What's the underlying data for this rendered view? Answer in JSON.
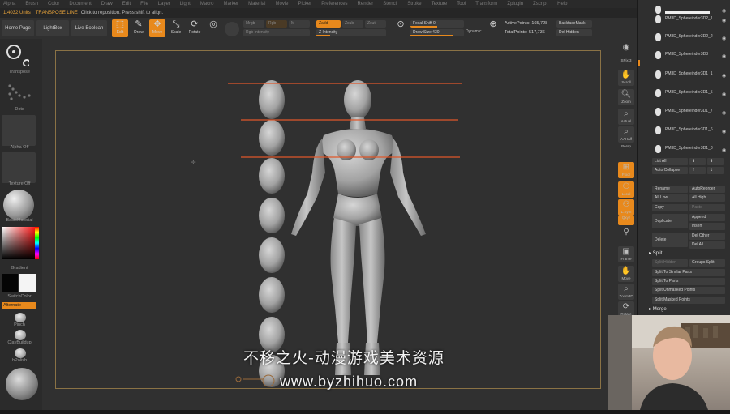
{
  "menubar": {
    "items": [
      "Alpha",
      "Brush",
      "Color",
      "Document",
      "Draw",
      "Edit",
      "File",
      "Layer",
      "Light",
      "Macro",
      "Marker",
      "Material",
      "Movie",
      "Picker",
      "Preferences",
      "Render",
      "Stencil",
      "Stroke",
      "Texture",
      "Tool",
      "Transform",
      "Zplugin",
      "Zscript",
      "Help"
    ]
  },
  "info": {
    "units": "1.4032 Units",
    "mode": "TRANSPOSE LINE",
    "hint": "Click to reposition. Press shift to align."
  },
  "top": {
    "home": "Home Page",
    "lightbox": "LightBox",
    "liveboolean": "Live Boolean",
    "edit": "Edit",
    "draw": "Draw",
    "move": "Move",
    "scale": "Scale",
    "rotate": "Rotate",
    "mrgb": "Mrgb",
    "rgb": "Rgb",
    "m": "M",
    "zadd": "Zadd",
    "zsub": "Zsub",
    "zcut": "Zcut",
    "rgb_intensity": "Rgb Intensity",
    "z_intensity": "Z Intensity",
    "focal_shift": "Focal Shift 0",
    "draw_size": "Draw Size 430",
    "dynamic": "Dynamic",
    "active_points": "ActivePoints: 165,728",
    "total_points": "TotalPoints: 517,736",
    "backface": "BackfaceMask",
    "del_hidden": "Del Hidden"
  },
  "left": {
    "transpose": "Transpose",
    "stroke": "Dots",
    "alpha": "Alpha Off",
    "texture": "Texture Off",
    "material": "BasicMaterial",
    "gradient": "Gradient",
    "switchcolor": "SwitchColor",
    "alternate": "Alternate",
    "brush1": "Pinch",
    "brush2": "ClayBuildup",
    "brush3": "hPolish"
  },
  "right": {
    "spix": "SPix 3",
    "scroll": "Scroll",
    "zoom": "Zoom",
    "actual": "Actual",
    "aahalf": "AAHalf",
    "persp": "Persp",
    "floor": "Floor",
    "local": "Local",
    "lsym": "L.Sym",
    "xyz": "Qxyz",
    "frame": "Frame",
    "move": "Move",
    "zoom3d": "Zoom3D",
    "rotate": "Rotate"
  },
  "subtool": {
    "items": [
      {
        "name": "PM3D_Sphereinder3D2_1"
      },
      {
        "name": "PM3D_Sphereinder3D2_2"
      },
      {
        "name": "PM3D_Sphereinder3D3"
      },
      {
        "name": "PM3D_Sphereinder3D1_1"
      },
      {
        "name": "PM3D_Sphereinder3D1_5"
      },
      {
        "name": "PM3D_Sphereinder3D1_7"
      },
      {
        "name": "PM3D_Sphereinder3D1_6"
      },
      {
        "name": "PM3D_Sphereinder3D1_8"
      }
    ],
    "list_all": "List All",
    "auto_collapse": "Auto Collapse",
    "rename": "Rename",
    "autoreorder": "AutoReorder",
    "all_low": "All Low",
    "all_high": "All High",
    "copy": "Copy",
    "paste": "Paste",
    "duplicate": "Duplicate",
    "append": "Append",
    "insert": "Insert",
    "delete": "Delete",
    "del_other": "Del Other",
    "del_all": "Del All",
    "split_head": "Split",
    "split_hidden": "Split Hidden",
    "groups_split": "Groups Split",
    "split_similar": "Split To Similar Parts",
    "split_parts": "Split To Parts",
    "split_unmasked": "Split Unmasked Points",
    "split_masked": "Split Masked Points",
    "merge_head": "Merge"
  },
  "watermark": {
    "line1": "不移之火-动漫游戏美术资源",
    "line2": "www.byzhihuo.com"
  }
}
